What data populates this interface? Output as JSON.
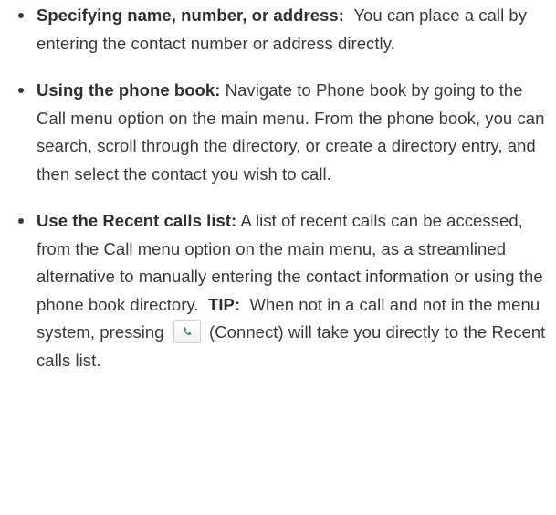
{
  "items": [
    {
      "term": "Specifying name, number, or address:",
      "body": "You can place a call by entering the contact number or address directly."
    },
    {
      "term": "Using the phone book:",
      "body": "Navigate to Phone book by going to the Call menu option on the main menu. From the phone book, you can search, scroll through the directory, or create a directory entry, and then select the contact you wish to call."
    },
    {
      "term": "Use the Recent calls list:",
      "body": "A list of recent calls can be accessed, from the Call menu option on the main menu, as a streamlined alternative to manually entering the contact information or using the phone book directory.",
      "tip_label": "TIP:",
      "tip_before": "When not in a call and not in the menu system, pressing",
      "tip_after": "(Connect) will take you directly to the Recent calls list."
    }
  ],
  "icons": {
    "connect": "connect-call-icon"
  },
  "colors": {
    "text": "#3a3a3a",
    "icon_green": "#2e9d2e"
  }
}
